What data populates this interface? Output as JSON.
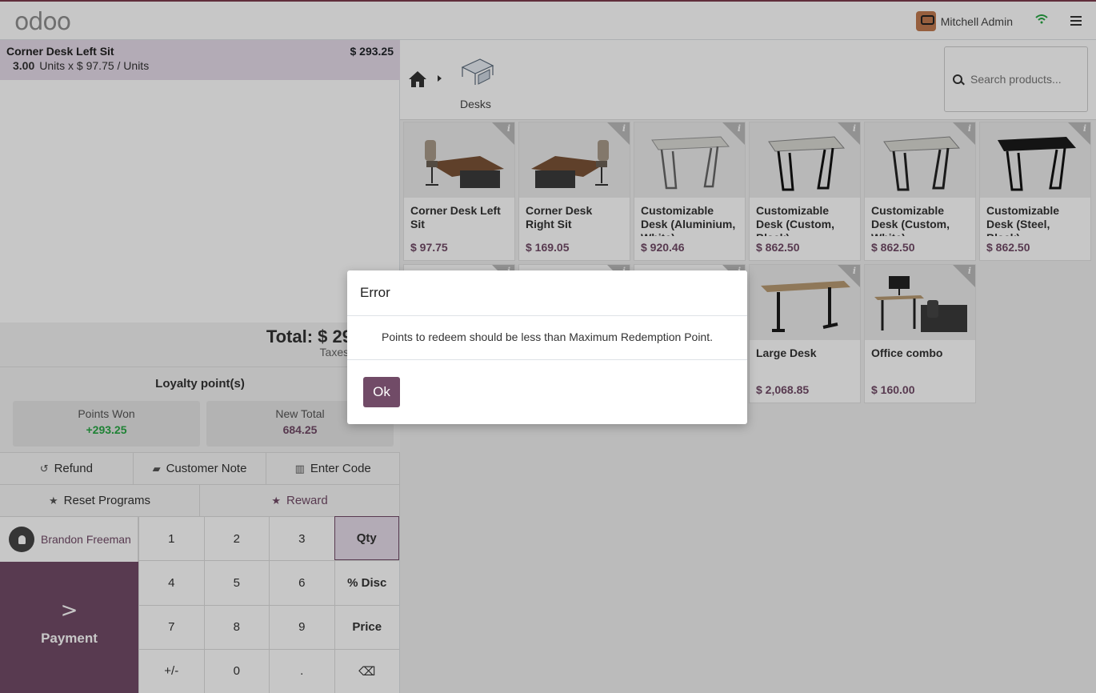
{
  "topbar": {
    "logo": "odoo",
    "user_name": "Mitchell Admin"
  },
  "order": {
    "line": {
      "name": "Corner Desk Left Sit",
      "price": "$ 293.25",
      "qty": "3.00",
      "detail": "Units x $ 97.75 / Units"
    },
    "total_label": "Total: $ 29",
    "taxes_label": "Taxes:"
  },
  "loyalty": {
    "title": "Loyalty point(s)",
    "points_won_label": "Points Won",
    "points_won_value": "+293.25",
    "new_total_label": "New Total",
    "new_total_value": "684.25"
  },
  "controls": {
    "refund": "Refund",
    "customer_note": "Customer Note",
    "enter_code": "Enter Code",
    "reset_programs": "Reset Programs",
    "reward": "Reward"
  },
  "customer": {
    "name": "Brandon Freeman"
  },
  "payment": {
    "chevron": ">",
    "label": "Payment"
  },
  "numpad": {
    "keys": [
      "1",
      "2",
      "3",
      "Qty",
      "4",
      "5",
      "6",
      "% Disc",
      "7",
      "8",
      "9",
      "Price",
      "+/-",
      "0",
      ".",
      "⌫"
    ]
  },
  "breadcrumb": {
    "category": "Desks"
  },
  "search": {
    "placeholder": "Search products..."
  },
  "products": [
    {
      "name": "Corner Desk Left Sit",
      "price": "$ 97.75"
    },
    {
      "name": "Corner Desk Right Sit",
      "price": "$ 169.05"
    },
    {
      "name": "Customizable Desk (Aluminium, White)",
      "price": "$ 920.46"
    },
    {
      "name": "Customizable Desk (Custom, Black)",
      "price": "$ 862.50"
    },
    {
      "name": "Customizable Desk (Custom, White)",
      "price": "$ 862.50"
    },
    {
      "name": "Customizable Desk (Steel, Black)",
      "price": "$ 862.50"
    },
    {
      "name": "",
      "price": ""
    },
    {
      "name": "",
      "price": ""
    },
    {
      "name": "",
      "price": ""
    },
    {
      "name": "Large Desk",
      "price": "$ 2,068.85"
    },
    {
      "name": "Office combo",
      "price": "$ 160.00"
    }
  ],
  "dialog": {
    "title": "Error",
    "message": "Points to redeem should be less than Maximum Redemption Point.",
    "ok_label": "Ok"
  },
  "colors": {
    "brand": "#714b67",
    "positive": "#28a745"
  }
}
